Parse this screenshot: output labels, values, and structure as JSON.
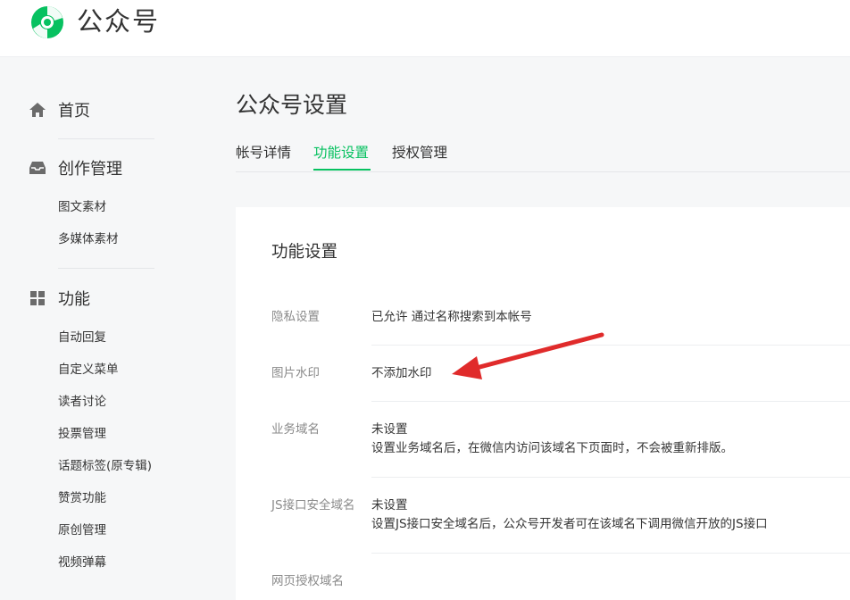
{
  "header": {
    "brand": "公众号"
  },
  "sidebar": {
    "home": "首页",
    "creation": {
      "title": "创作管理",
      "items": [
        "图文素材",
        "多媒体素材"
      ]
    },
    "features": {
      "title": "功能",
      "items": [
        "自动回复",
        "自定义菜单",
        "读者讨论",
        "投票管理",
        "话题标签(原专辑)",
        "赞赏功能",
        "原创管理",
        "视频弹幕"
      ]
    }
  },
  "main": {
    "title": "公众号设置",
    "tabs": [
      "帐号详情",
      "功能设置",
      "授权管理"
    ],
    "active_tab": "功能设置",
    "card": {
      "title": "功能设置",
      "rows": [
        {
          "label": "隐私设置",
          "value": "已允许 通过名称搜索到本帐号"
        },
        {
          "label": "图片水印",
          "value": "不添加水印"
        },
        {
          "label": "业务域名",
          "value": "未设置",
          "desc": "设置业务域名后，在微信内访问该域名下页面时，不会被重新排版。"
        },
        {
          "label": "JS接口安全域名",
          "value": "未设置",
          "desc": "设置JS接口安全域名后，公众号开发者可在该域名下调用微信开放的JS接口"
        },
        {
          "label": "网页授权域名"
        }
      ]
    }
  },
  "colors": {
    "accent": "#07c160",
    "arrow": "#e02b2b"
  }
}
